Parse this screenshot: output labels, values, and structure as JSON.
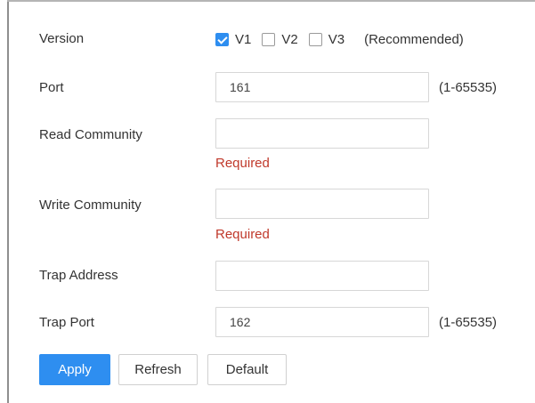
{
  "form": {
    "version": {
      "label": "Version",
      "options": [
        {
          "label": "V1",
          "checked": true
        },
        {
          "label": "V2",
          "checked": false
        },
        {
          "label": "V3",
          "checked": false
        }
      ],
      "note": "(Recommended)"
    },
    "port": {
      "label": "Port",
      "value": "161",
      "hint": "(1-65535)"
    },
    "read_community": {
      "label": "Read Community",
      "value": "",
      "error": "Required"
    },
    "write_community": {
      "label": "Write Community",
      "value": "",
      "error": "Required"
    },
    "trap_address": {
      "label": "Trap Address",
      "value": ""
    },
    "trap_port": {
      "label": "Trap Port",
      "value": "162",
      "hint": "(1-65535)"
    }
  },
  "buttons": {
    "apply": "Apply",
    "refresh": "Refresh",
    "default": "Default"
  },
  "colors": {
    "accent": "#2e8ef0",
    "error": "#c0392b",
    "text": "#333333",
    "border": "#d7d7d7"
  }
}
